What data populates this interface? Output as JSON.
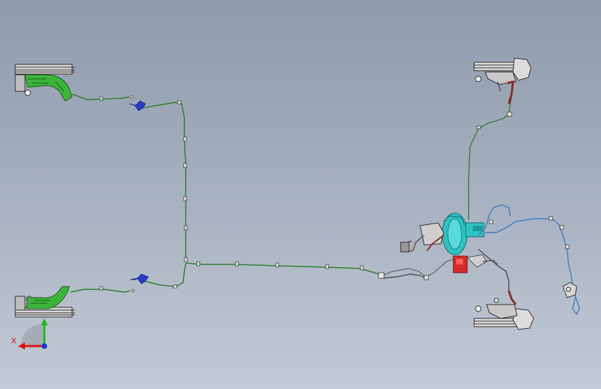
{
  "view": {
    "colors": {
      "bg_top": "#8e9bac",
      "bg_bottom": "#c3cad5",
      "rear_line": "#2f7d2f",
      "rear_caliper": "#3cb43c",
      "rear_hose": "#2b3cc9",
      "front_hose_left": "#8b2a2a",
      "brake_booster": "#2fc3c3",
      "abs_module": "#d62a2a",
      "sensor_wire": "#3f78c8",
      "main_line": "#6a6a6a",
      "hardware": "#3a3a3a"
    }
  },
  "triad": {
    "x_label": "X",
    "icons": [
      "axis-x-arrow-icon",
      "axis-y-arrow-icon",
      "origin-dot-icon"
    ]
  }
}
